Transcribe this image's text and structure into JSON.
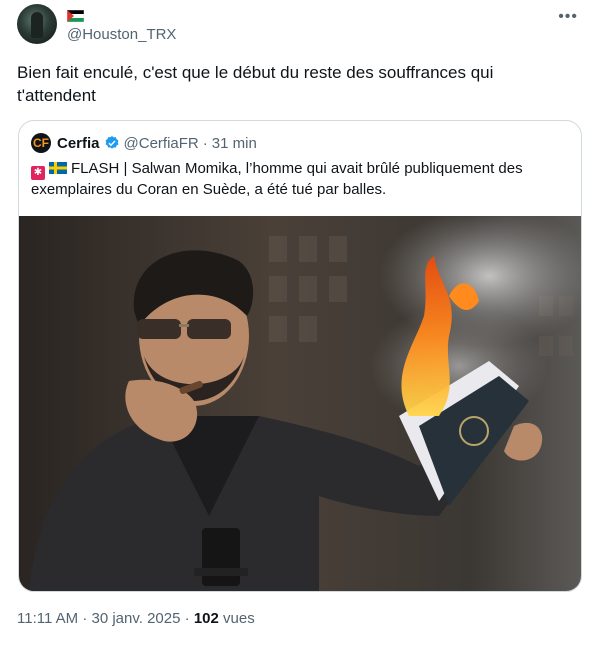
{
  "author": {
    "handle": "@Houston_TRX",
    "flag_icon": "palestine-flag-icon"
  },
  "tweet": {
    "text": "Bien fait enculé, c'est que le début du reste des souffrances qui t'attendent"
  },
  "quoted": {
    "name": "Cerfia",
    "avatar_text": "CF",
    "handle": "@CerfiaFR",
    "separator": "·",
    "time": "31 min",
    "text": "FLASH | Salwan Momika, l’homme qui avait brûlé publiquement des exemplaires du Coran en Suède, a été tué par balles.",
    "emojis": [
      "alarm-emoji-icon",
      "sweden-flag-icon"
    ]
  },
  "footer": {
    "time": "11:11 AM",
    "sep1": "·",
    "date": "30 janv. 2025",
    "sep2": "·",
    "views": "102",
    "views_label": "vues"
  },
  "colors": {
    "text": "#0f1419",
    "secondary": "#536471",
    "border": "#cfd9de",
    "verified": "#1d9bf0"
  }
}
